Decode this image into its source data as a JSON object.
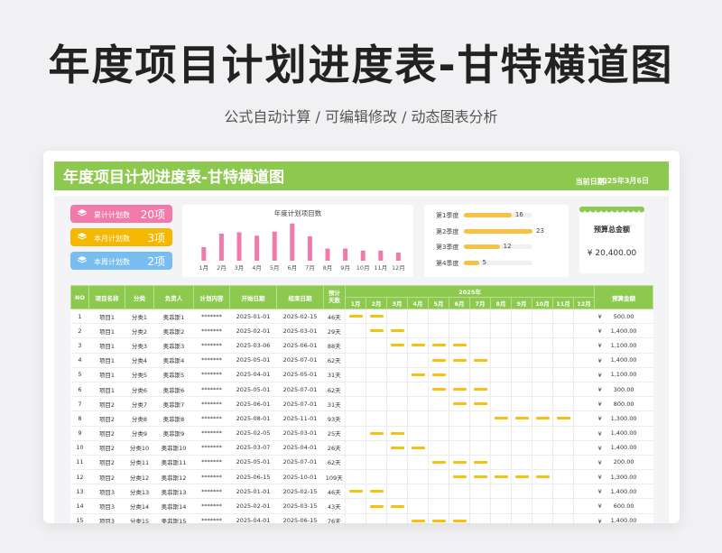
{
  "hero": {
    "title": "年度项目计划进度表-甘特横道图",
    "subtitle": "公式自动计算 /  可编辑修改  / 动态图表分析"
  },
  "banner": {
    "title": "年度项目计划进度表-甘特横道图",
    "date_label": "当前日期:",
    "date_value": "2025年3月6日"
  },
  "stats": [
    {
      "label": "累计计划数",
      "value": "20项",
      "color": "#f07bab"
    },
    {
      "label": "本月计划数",
      "value": "3项",
      "color": "#f5b800"
    },
    {
      "label": "本周计划数",
      "value": "2项",
      "color": "#78bdf0"
    }
  ],
  "chart_data": {
    "type": "bar",
    "title": "年度计划项目数",
    "categories": [
      "1月",
      "2月",
      "3月",
      "4月",
      "5月",
      "6月",
      "7月",
      "8月",
      "9月",
      "10月",
      "11月",
      "12月"
    ],
    "values": [
      2,
      4,
      4.2,
      3.7,
      4.3,
      5.5,
      3.6,
      1.8,
      1.8,
      1.5,
      1.5,
      1.2
    ],
    "color": "#f07bab",
    "ylim": [
      0,
      6
    ]
  },
  "quarters": {
    "max": 23,
    "color": "#f6c244",
    "items": [
      {
        "label": "第1季度",
        "value": 16
      },
      {
        "label": "第2季度",
        "value": 23
      },
      {
        "label": "第3季度",
        "value": 12
      },
      {
        "label": "第4季度",
        "value": 5
      }
    ]
  },
  "budget": {
    "label": "预算总金额",
    "value": "¥ 20,400.00"
  },
  "table": {
    "headers": {
      "no": "NO",
      "name": "项目名称",
      "cat": "分类",
      "owner": "负责人",
      "content": "计划内容",
      "start": "开始日期",
      "end": "结束日期",
      "days": "预计\n天数",
      "year": "2025年",
      "amount": "预算金额"
    },
    "months": [
      "1月",
      "2月",
      "3月",
      "4月",
      "5月",
      "6月",
      "7月",
      "8月",
      "9月",
      "10月",
      "11月",
      "12月"
    ],
    "currency": "¥",
    "rows": [
      {
        "no": "1",
        "name": "项目1",
        "cat": "分类1",
        "owner": "奥菲斯1",
        "content": "*******",
        "start": "2025-01-01",
        "end": "2025-02-15",
        "days": "46天",
        "amount": "500.00",
        "months": [
          1,
          2
        ]
      },
      {
        "no": "2",
        "name": "项目1",
        "cat": "分类2",
        "owner": "奥菲斯2",
        "content": "*******",
        "start": "2025-02-01",
        "end": "2025-03-01",
        "days": "29天",
        "amount": "1,400.00",
        "months": [
          2,
          3
        ]
      },
      {
        "no": "3",
        "name": "项目1",
        "cat": "分类3",
        "owner": "奥菲斯3",
        "content": "*******",
        "start": "2025-03-06",
        "end": "2025-06-01",
        "days": "88天",
        "amount": "1,100.00",
        "months": [
          3,
          4,
          5,
          6
        ]
      },
      {
        "no": "4",
        "name": "项目1",
        "cat": "分类4",
        "owner": "奥菲斯4",
        "content": "*******",
        "start": "2025-05-01",
        "end": "2025-07-01",
        "days": "62天",
        "amount": "1,400.00",
        "months": [
          5,
          6,
          7
        ]
      },
      {
        "no": "5",
        "name": "项目1",
        "cat": "分类5",
        "owner": "奥菲斯5",
        "content": "*******",
        "start": "2025-04-01",
        "end": "2025-05-01",
        "days": "31天",
        "amount": "1,100.00",
        "months": [
          4,
          5
        ]
      },
      {
        "no": "6",
        "name": "项目1",
        "cat": "分类6",
        "owner": "奥菲斯6",
        "content": "*******",
        "start": "2025-05-01",
        "end": "2025-07-01",
        "days": "62天",
        "amount": "300.00",
        "months": [
          5,
          6,
          7
        ]
      },
      {
        "no": "7",
        "name": "项目2",
        "cat": "分类7",
        "owner": "奥菲斯7",
        "content": "*******",
        "start": "2025-06-01",
        "end": "2025-07-01",
        "days": "31天",
        "amount": "800.00",
        "months": [
          6,
          7
        ]
      },
      {
        "no": "8",
        "name": "项目2",
        "cat": "分类8",
        "owner": "奥菲斯8",
        "content": "*******",
        "start": "2025-08-01",
        "end": "2025-11-01",
        "days": "93天",
        "amount": "1,300.00",
        "months": [
          8,
          9,
          10,
          11
        ]
      },
      {
        "no": "9",
        "name": "项目2",
        "cat": "分类9",
        "owner": "奥菲斯9",
        "content": "*******",
        "start": "2025-02-05",
        "end": "2025-03-01",
        "days": "25天",
        "amount": "1,400.00",
        "months": [
          2,
          3
        ]
      },
      {
        "no": "10",
        "name": "项目2",
        "cat": "分类10",
        "owner": "奥菲斯10",
        "content": "*******",
        "start": "2025-03-07",
        "end": "2025-04-01",
        "days": "26天",
        "amount": "1,400.00",
        "months": [
          3,
          4
        ]
      },
      {
        "no": "11",
        "name": "项目2",
        "cat": "分类11",
        "owner": "奥菲斯11",
        "content": "*******",
        "start": "2025-05-01",
        "end": "2025-07-01",
        "days": "62天",
        "amount": "200.00",
        "months": [
          5,
          6,
          7
        ]
      },
      {
        "no": "12",
        "name": "项目2",
        "cat": "分类12",
        "owner": "奥菲斯12",
        "content": "*******",
        "start": "2025-06-15",
        "end": "2025-10-01",
        "days": "109天",
        "amount": "1,300.00",
        "months": [
          6,
          7,
          8,
          9,
          10
        ]
      },
      {
        "no": "13",
        "name": "项目3",
        "cat": "分类13",
        "owner": "奥菲斯13",
        "content": "*******",
        "start": "2025-01-01",
        "end": "2025-02-15",
        "days": "46天",
        "amount": "1,400.00",
        "months": [
          1,
          2
        ]
      },
      {
        "no": "14",
        "name": "项目3",
        "cat": "分类14",
        "owner": "奥菲斯14",
        "content": "*******",
        "start": "2025-02-01",
        "end": "2025-03-15",
        "days": "43天",
        "amount": "600.00",
        "months": [
          2,
          3
        ]
      },
      {
        "no": "15",
        "name": "项目3",
        "cat": "分类15",
        "owner": "奥菲斯15",
        "content": "*******",
        "start": "2025-04-01",
        "end": "2025-06-15",
        "days": "76天",
        "amount": "1,400.00",
        "months": [
          4,
          5,
          6
        ]
      }
    ]
  }
}
